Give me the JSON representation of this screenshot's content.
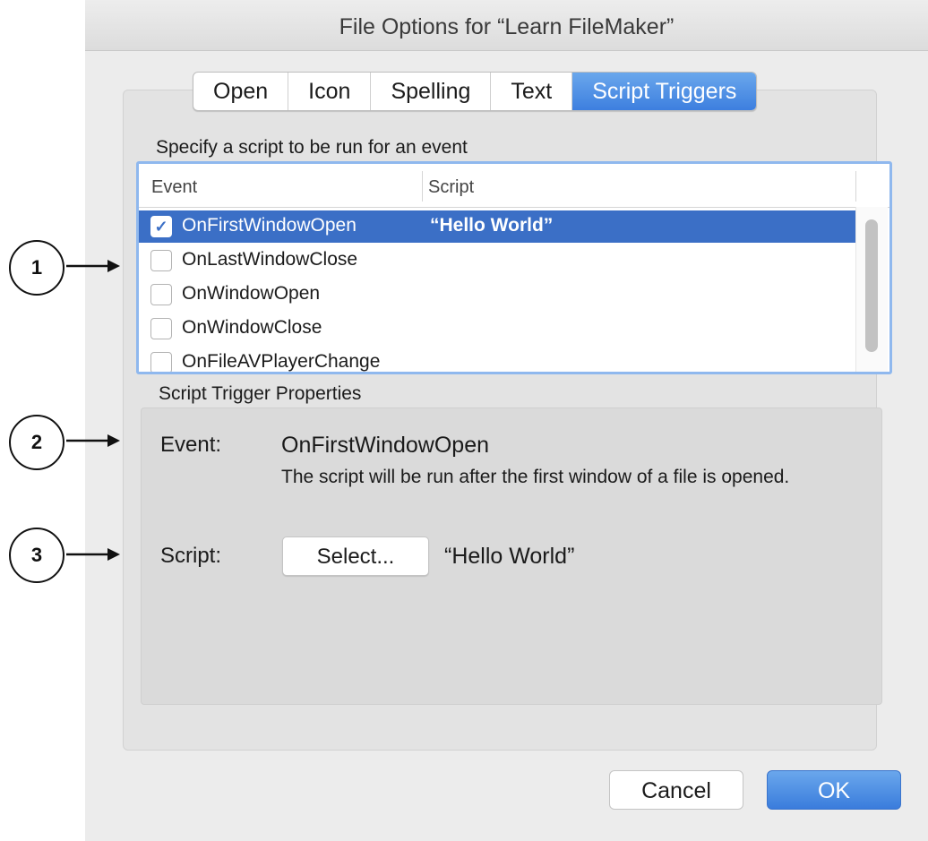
{
  "window": {
    "title": "File Options for “Learn FileMaker”"
  },
  "tabs": [
    {
      "label": "Open",
      "active": false
    },
    {
      "label": "Icon",
      "active": false
    },
    {
      "label": "Spelling",
      "active": false
    },
    {
      "label": "Text",
      "active": false
    },
    {
      "label": "Script Triggers",
      "active": true
    }
  ],
  "list": {
    "caption": "Specify a script to be run for an event",
    "headers": {
      "event": "Event",
      "script": "Script"
    },
    "rows": [
      {
        "event": "OnFirstWindowOpen",
        "script": "“Hello World”",
        "checked": true,
        "selected": true
      },
      {
        "event": "OnLastWindowClose",
        "script": "",
        "checked": false,
        "selected": false
      },
      {
        "event": "OnWindowOpen",
        "script": "",
        "checked": false,
        "selected": false
      },
      {
        "event": "OnWindowClose",
        "script": "",
        "checked": false,
        "selected": false
      },
      {
        "event": "OnFileAVPlayerChange",
        "script": "",
        "checked": false,
        "selected": false
      }
    ],
    "checkmark": "✓"
  },
  "properties": {
    "caption": "Script Trigger Properties",
    "event_label": "Event:",
    "event_value": "OnFirstWindowOpen",
    "description": "The script will be run after the first window of a file is opened.",
    "script_label": "Script:",
    "select_button": "Select...",
    "script_value": "“Hello World”"
  },
  "buttons": {
    "cancel": "Cancel",
    "ok": "OK"
  },
  "callouts": [
    "1",
    "2",
    "3"
  ],
  "colors": {
    "accent": "#3b6fc6",
    "focus_ring": "#8fb8ee"
  }
}
